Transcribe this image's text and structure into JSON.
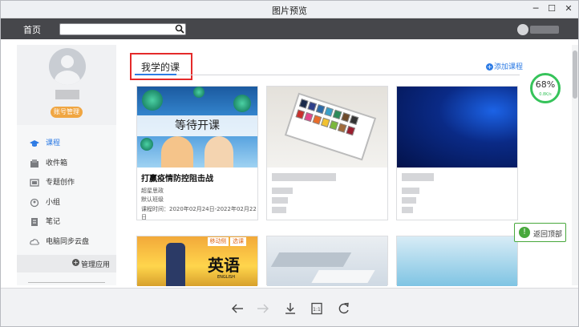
{
  "window": {
    "title": "图片预览"
  },
  "navbar": {
    "home_label": "首页",
    "search_placeholder": ""
  },
  "sidebar": {
    "manage_button": "账号管理",
    "items": [
      {
        "label": "课程",
        "icon": "graduation-cap-icon",
        "active": true
      },
      {
        "label": "收件箱",
        "icon": "inbox-icon"
      },
      {
        "label": "专题创作",
        "icon": "topic-icon"
      },
      {
        "label": "小组",
        "icon": "group-icon"
      },
      {
        "label": "笔记",
        "icon": "note-icon"
      },
      {
        "label": "电脑同步云盘",
        "icon": "cloud-icon"
      }
    ],
    "manage_apps": "管理应用"
  },
  "main": {
    "section_title": "我学的课",
    "add_course": "添加课程",
    "courses": [
      {
        "cover_text": "等待开课",
        "title": "打赢疫情防控阻击战",
        "teacher": "超星思政",
        "class": "默认班级",
        "time": "课程时间：2020年02月24日-2022年02月22日"
      },
      {
        "cover_text": "",
        "title": ""
      },
      {
        "cover_text": "",
        "title": ""
      },
      {
        "cover_tags": [
          "移动侧",
          "选课"
        ],
        "cover_text": "英语",
        "cover_sub": "ENGLISH"
      },
      {
        "cover_text": ""
      },
      {
        "cover_text": ""
      }
    ]
  },
  "widget": {
    "percent": "68%",
    "rate": "0.8K/s"
  },
  "back_to_top": "返回顶部",
  "colors": {
    "accent": "#2d7be4",
    "highlight_box": "#e42a2a",
    "green": "#36c35a",
    "orange": "#f0a642"
  }
}
